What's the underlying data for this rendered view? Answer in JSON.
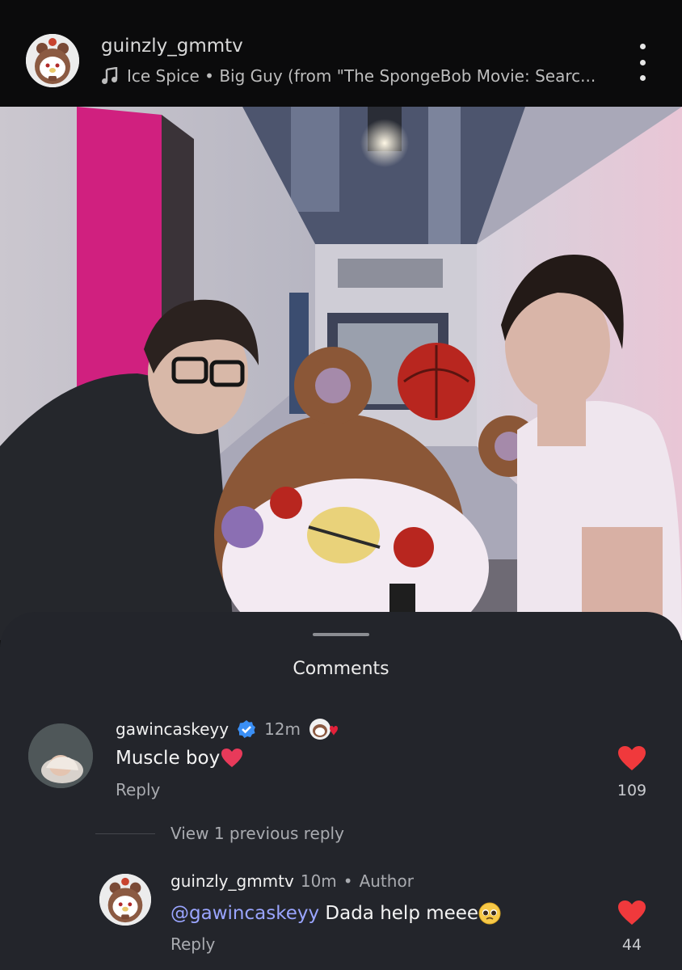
{
  "header": {
    "username": "guinzly_gmmtv",
    "music_text": "Ice Spice • Big Guy (from \"The SpongeBob Movie: Searc...",
    "music_icon": "music-note-icon",
    "more_icon": "more-vertical-icon"
  },
  "sheet": {
    "title": "Comments"
  },
  "comments": [
    {
      "username": "gawincaskeyy",
      "verified": true,
      "time": "12m",
      "text": "Muscle boy",
      "emoji": "red-heart",
      "reply_label": "Reply",
      "likes": "109"
    },
    {
      "view_previous": "View 1 previous reply",
      "username": "guinzly_gmmtv",
      "time": "10m",
      "separator": "•",
      "author_label": "Author",
      "mention": "@gawincaskeyy",
      "text": " Dada help meee",
      "emoji": "pleading-face",
      "reply_label": "Reply",
      "likes": "44"
    }
  ],
  "colors": {
    "sheet_bg": "#23252b",
    "heart": "#f0393c",
    "verified": "#3a8ff5",
    "mention": "#9aa5ff"
  }
}
